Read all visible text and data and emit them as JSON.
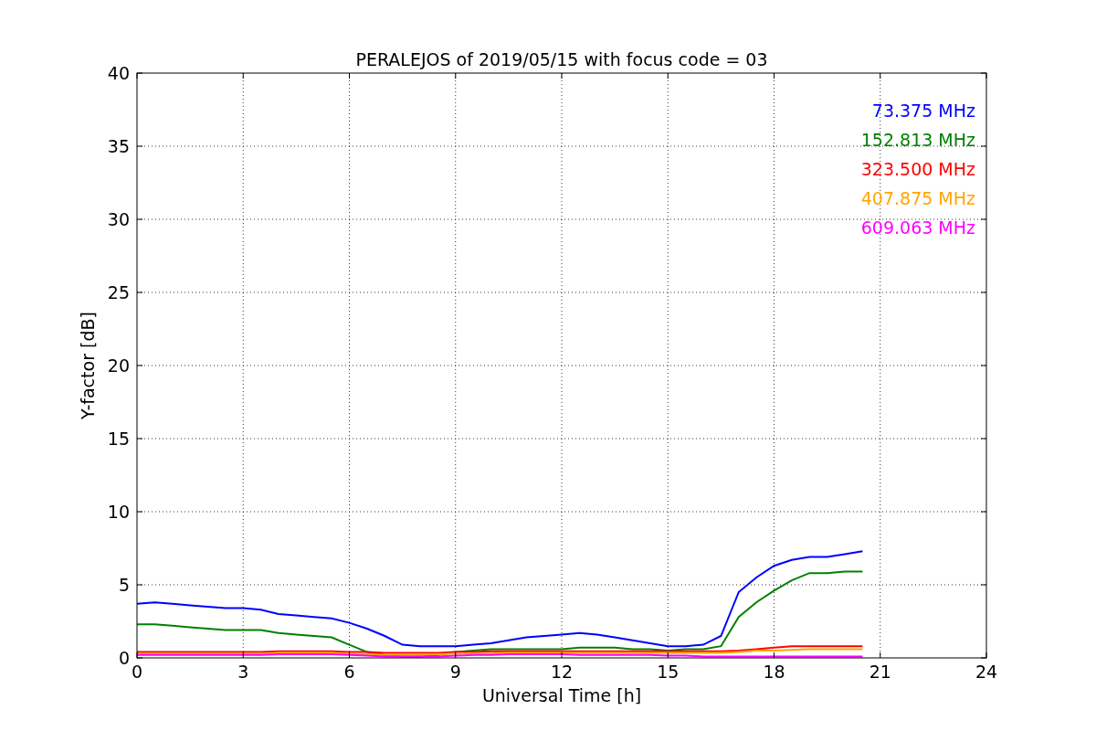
{
  "chart_data": {
    "type": "line",
    "title": "PERALEJOS of 2019/05/15 with focus code = 03",
    "xlabel": "Universal Time [h]",
    "ylabel": "Y-factor [dB]",
    "x": [
      0,
      0.5,
      1,
      1.5,
      2,
      2.5,
      3,
      3.5,
      4,
      4.5,
      5,
      5.5,
      6,
      6.5,
      7,
      7.5,
      8,
      8.5,
      9,
      9.5,
      10,
      10.5,
      11,
      11.5,
      12,
      12.5,
      13,
      13.5,
      14,
      14.5,
      15,
      15.5,
      16,
      16.5,
      17,
      17.5,
      18,
      18.5,
      19,
      19.5,
      20,
      20.5
    ],
    "series": [
      {
        "name": "73.375 MHz",
        "color": "#0000ff",
        "values": [
          3.7,
          3.8,
          3.7,
          3.6,
          3.5,
          3.4,
          3.4,
          3.3,
          3.0,
          2.9,
          2.8,
          2.7,
          2.4,
          2.0,
          1.5,
          0.9,
          0.8,
          0.8,
          0.8,
          0.9,
          1.0,
          1.2,
          1.4,
          1.5,
          1.6,
          1.7,
          1.6,
          1.4,
          1.2,
          1.0,
          0.8,
          0.8,
          0.9,
          1.5,
          4.5,
          5.5,
          6.3,
          6.7,
          6.9,
          6.9,
          7.1,
          7.3
        ]
      },
      {
        "name": "152.813 MHz",
        "color": "#008000",
        "values": [
          2.3,
          2.3,
          2.2,
          2.1,
          2.0,
          1.9,
          1.9,
          1.9,
          1.7,
          1.6,
          1.5,
          1.4,
          0.9,
          0.4,
          0.2,
          0.1,
          0.1,
          0.2,
          0.4,
          0.5,
          0.6,
          0.6,
          0.6,
          0.6,
          0.6,
          0.7,
          0.7,
          0.7,
          0.6,
          0.6,
          0.5,
          0.6,
          0.6,
          0.8,
          2.8,
          3.8,
          4.6,
          5.3,
          5.8,
          5.8,
          5.9,
          5.9
        ]
      },
      {
        "name": "323.500 MHz",
        "color": "#ff0000",
        "values": [
          0.4,
          0.4,
          0.4,
          0.4,
          0.4,
          0.4,
          0.4,
          0.4,
          0.45,
          0.45,
          0.45,
          0.45,
          0.4,
          0.4,
          0.35,
          0.35,
          0.35,
          0.35,
          0.4,
          0.4,
          0.45,
          0.45,
          0.45,
          0.45,
          0.45,
          0.45,
          0.45,
          0.45,
          0.45,
          0.45,
          0.45,
          0.45,
          0.45,
          0.45,
          0.5,
          0.6,
          0.7,
          0.8,
          0.8,
          0.8,
          0.8,
          0.8
        ]
      },
      {
        "name": "407.875 MHz",
        "color": "#ffa500",
        "values": [
          0.3,
          0.3,
          0.3,
          0.3,
          0.3,
          0.3,
          0.3,
          0.3,
          0.35,
          0.35,
          0.35,
          0.35,
          0.3,
          0.25,
          0.2,
          0.2,
          0.2,
          0.25,
          0.3,
          0.3,
          0.3,
          0.35,
          0.35,
          0.35,
          0.35,
          0.35,
          0.35,
          0.35,
          0.35,
          0.35,
          0.35,
          0.35,
          0.35,
          0.35,
          0.4,
          0.5,
          0.5,
          0.55,
          0.6,
          0.6,
          0.6,
          0.6
        ]
      },
      {
        "name": "609.063 MHz",
        "color": "#ff00ff",
        "values": [
          0.2,
          0.2,
          0.2,
          0.2,
          0.2,
          0.2,
          0.2,
          0.2,
          0.25,
          0.25,
          0.25,
          0.25,
          0.2,
          0.15,
          0.1,
          0.1,
          0.1,
          0.1,
          0.15,
          0.2,
          0.2,
          0.25,
          0.25,
          0.25,
          0.25,
          0.2,
          0.2,
          0.2,
          0.2,
          0.2,
          0.15,
          0.15,
          0.1,
          0.1,
          0.1,
          0.1,
          0.1,
          0.1,
          0.1,
          0.1,
          0.1,
          0.1
        ]
      }
    ],
    "grid": true,
    "xlim": [
      0,
      24
    ],
    "ylim": [
      0,
      40
    ],
    "xticks": [
      0,
      3,
      6,
      9,
      12,
      15,
      18,
      21,
      24
    ],
    "yticks": [
      0,
      5,
      10,
      15,
      20,
      25,
      30,
      35,
      40
    ]
  }
}
